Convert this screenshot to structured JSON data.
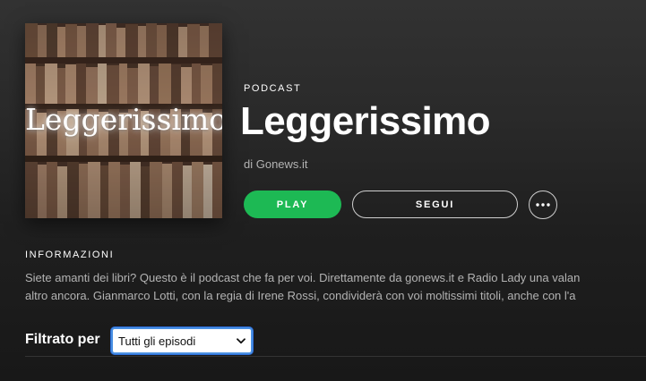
{
  "podcast": {
    "type_label": "PODCAST",
    "title": "Leggerissimo",
    "author": "di Gonews.it",
    "cover_text": "Leggerissimo"
  },
  "actions": {
    "play_label": "PLAY",
    "follow_label": "SEGUI",
    "more_icon": "ellipsis-icon"
  },
  "info": {
    "heading": "INFORMAZIONI",
    "lines": [
      "Siete amanti dei libri? Questo è il podcast che fa per voi. Direttamente da gonews.it e Radio Lady una valan",
      "altro ancora. Gianmarco Lotti, con la regia di Irene Rossi, condividerà con voi moltissimi titoli, anche con l'a"
    ]
  },
  "filter": {
    "label": "Filtrato per",
    "selected": "Tutti gli episodi"
  },
  "colors": {
    "accent": "#1db954",
    "muted_text": "#b3b3b3",
    "select_focus": "#4a90e2"
  }
}
